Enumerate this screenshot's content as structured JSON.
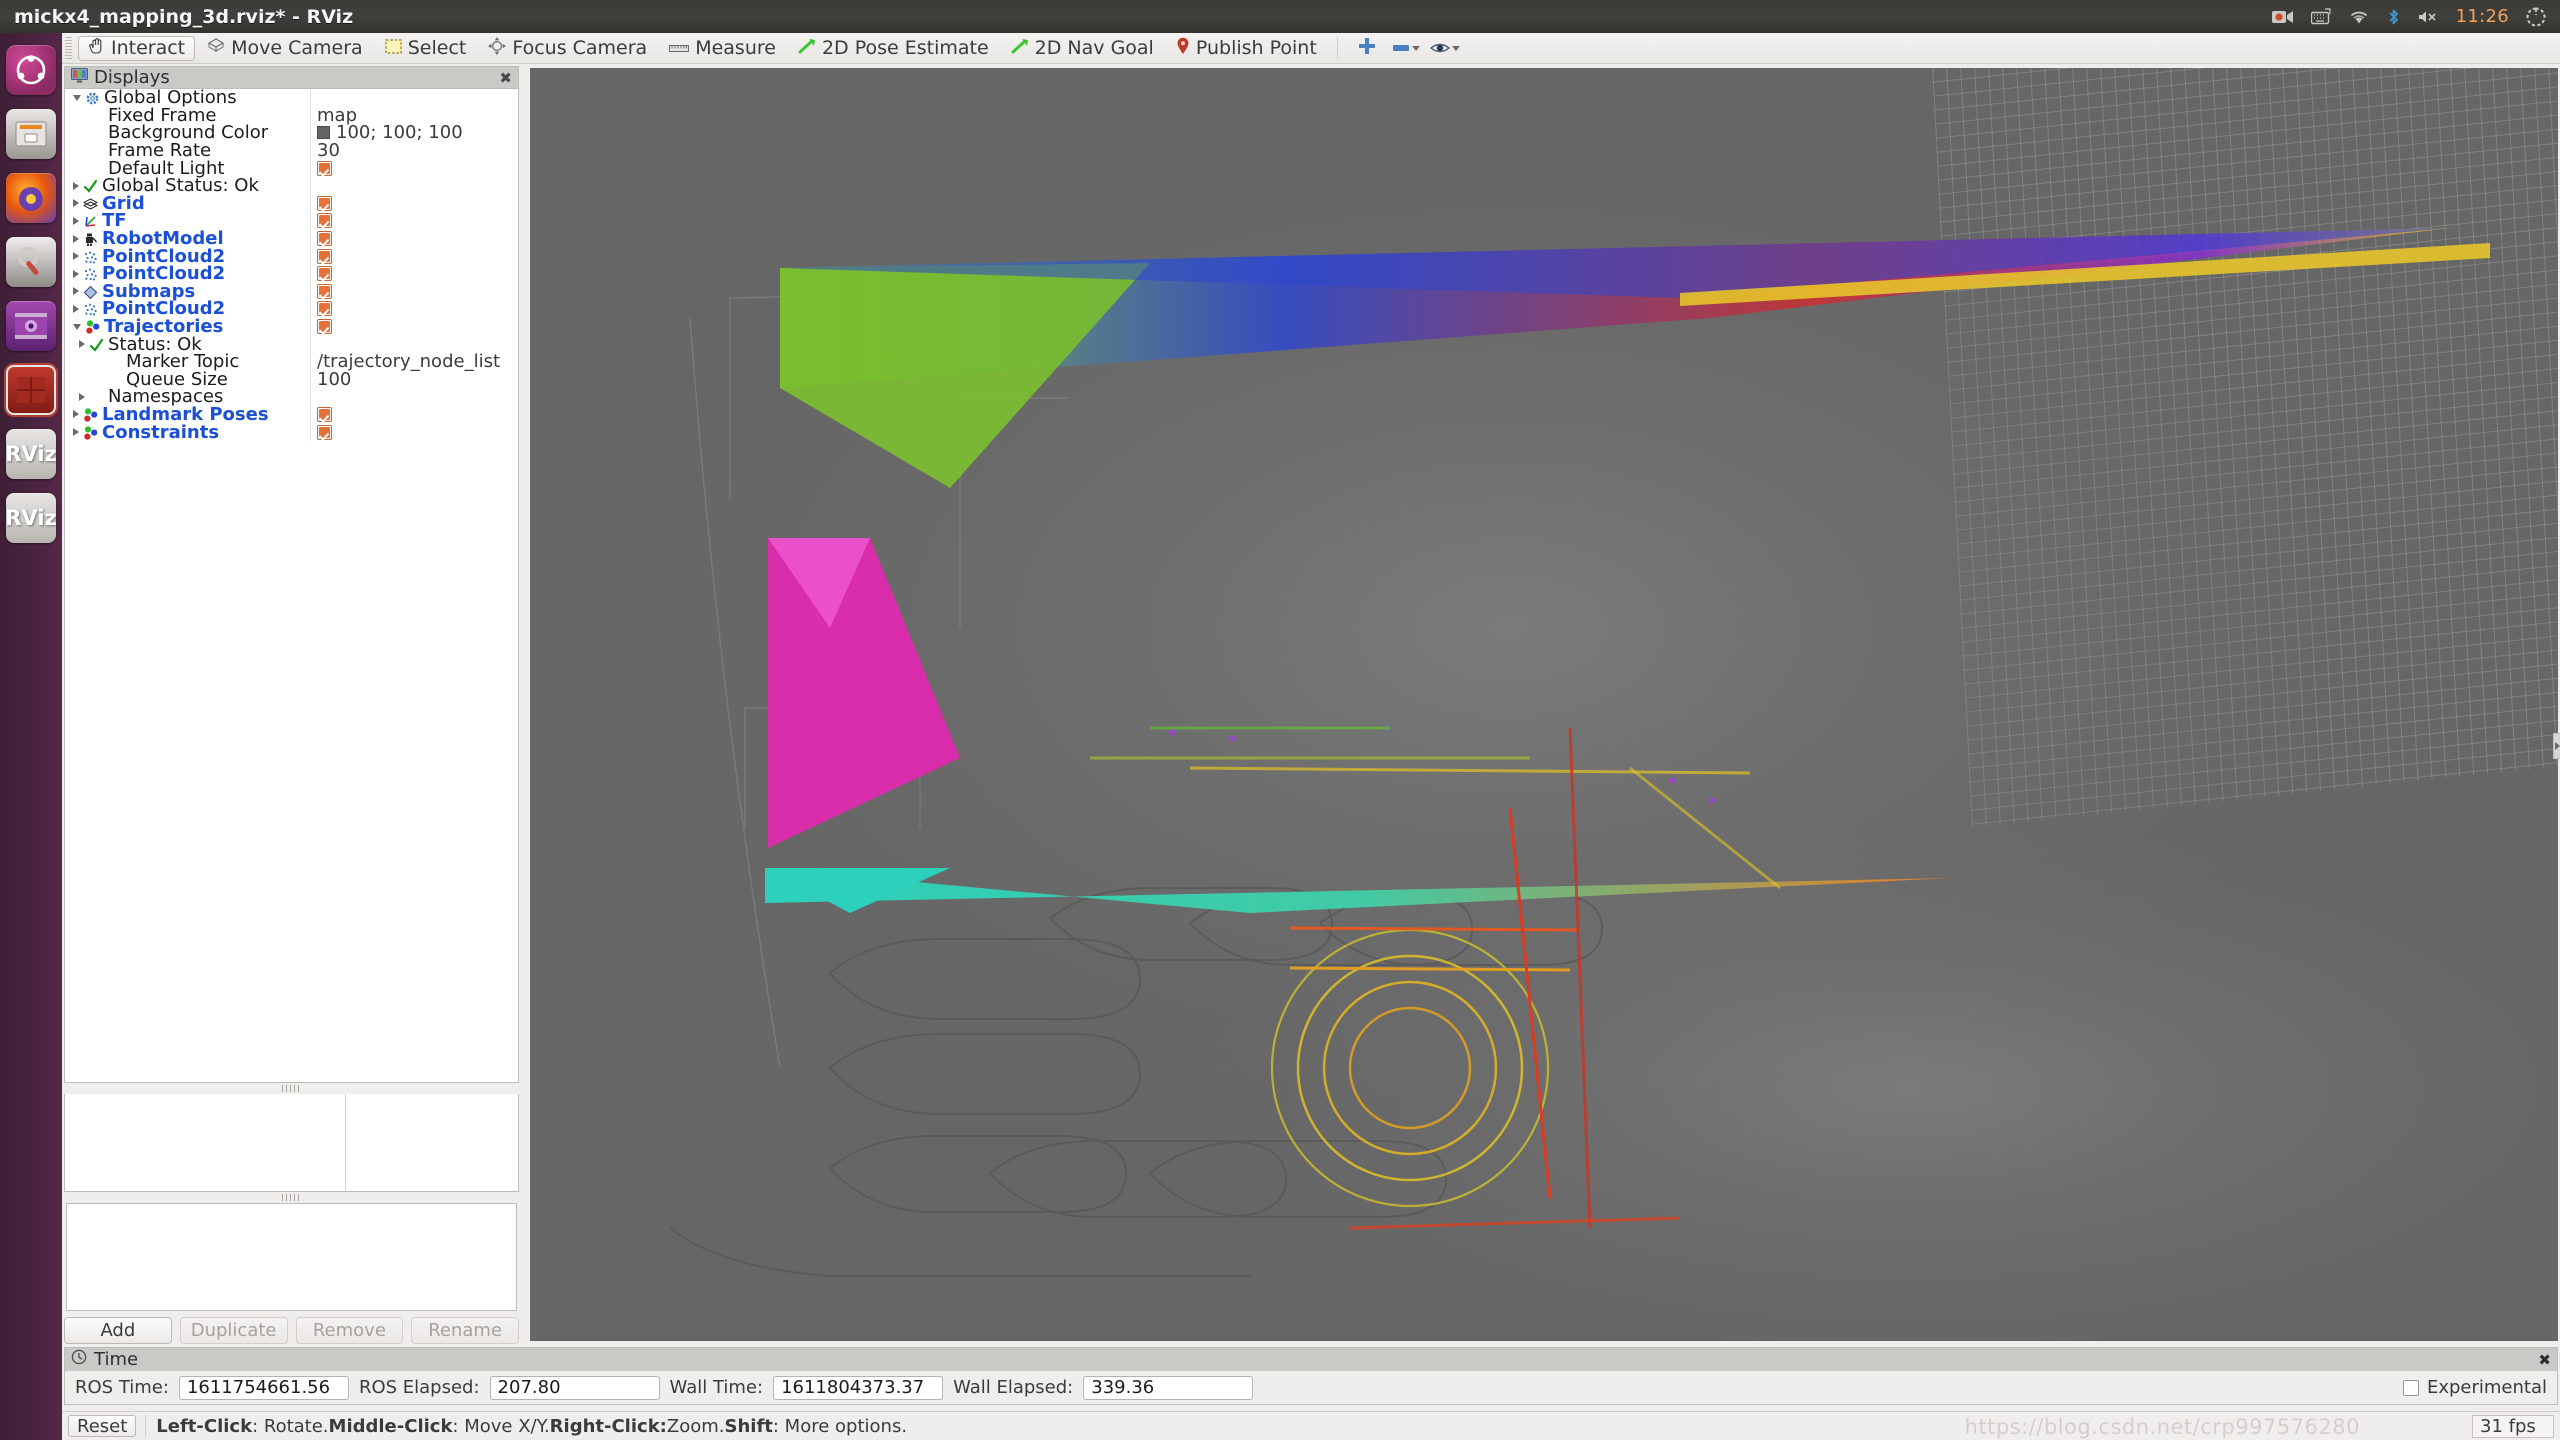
{
  "window": {
    "title": "mickx4_mapping_3d.rviz* - RViz"
  },
  "system_tray": {
    "icons": [
      "screen-record-icon",
      "keyboard-layout-icon",
      "wifi-icon",
      "bluetooth-icon",
      "volume-muted-icon"
    ],
    "clock": "11:26",
    "session_icon": "power-gear-icon"
  },
  "launcher": {
    "items": [
      {
        "name": "ubuntu-dash",
        "label": "Ubuntu"
      },
      {
        "name": "files",
        "label": "Files"
      },
      {
        "name": "firefox",
        "label": "Firefox"
      },
      {
        "name": "settings",
        "label": "System Settings"
      },
      {
        "name": "media-player",
        "label": "Media Player"
      },
      {
        "name": "terminator",
        "label": "Terminator"
      },
      {
        "name": "rviz-1",
        "label": "RViz"
      },
      {
        "name": "rviz-2",
        "label": "RViz"
      }
    ]
  },
  "toolbar": {
    "buttons": [
      {
        "label": "Interact",
        "icon": "hand-cursor-icon",
        "active": true
      },
      {
        "label": "Move Camera",
        "icon": "move-camera-icon",
        "active": false
      },
      {
        "label": "Select",
        "icon": "selection-rect-icon",
        "active": false
      },
      {
        "label": "Focus Camera",
        "icon": "focus-camera-icon",
        "active": false
      },
      {
        "label": "Measure",
        "icon": "ruler-icon",
        "active": false
      },
      {
        "label": "2D Pose Estimate",
        "icon": "green-arrow-icon",
        "active": false
      },
      {
        "label": "2D Nav Goal",
        "icon": "green-arrow-icon",
        "active": false
      },
      {
        "label": "Publish Point",
        "icon": "map-pin-icon",
        "active": false
      }
    ],
    "extra_icons": [
      "add-tool-icon",
      "remove-tool-icon",
      "visibility-eye-icon"
    ]
  },
  "displays_panel": {
    "header": "Displays",
    "header_icon": "display-monitor-icon",
    "close_icon": "close-icon",
    "rows": [
      {
        "indent": 0,
        "arrow": "down",
        "icon": "gear-icon",
        "label": "Global Options",
        "style": "plain",
        "value_type": "none"
      },
      {
        "indent": 1,
        "arrow": "none",
        "icon": "",
        "label": "Fixed Frame",
        "style": "plain",
        "value_type": "text",
        "value": "map"
      },
      {
        "indent": 1,
        "arrow": "none",
        "icon": "",
        "label": "Background Color",
        "style": "plain",
        "value_type": "color",
        "value": "100; 100; 100",
        "color": "#646464"
      },
      {
        "indent": 1,
        "arrow": "none",
        "icon": "",
        "label": "Frame Rate",
        "style": "plain",
        "value_type": "text",
        "value": "30"
      },
      {
        "indent": 1,
        "arrow": "none",
        "icon": "",
        "label": "Default Light",
        "style": "plain",
        "value_type": "check"
      },
      {
        "indent": 0,
        "arrow": "right",
        "icon": "status-ok-icon",
        "label": "Global Status: Ok",
        "style": "plain",
        "value_type": "none"
      },
      {
        "indent": 0,
        "arrow": "right",
        "icon": "grid-icon",
        "label": "Grid",
        "style": "blue",
        "value_type": "check"
      },
      {
        "indent": 0,
        "arrow": "right",
        "icon": "tf-axes-icon",
        "label": "TF",
        "style": "blue",
        "value_type": "check"
      },
      {
        "indent": 0,
        "arrow": "right",
        "icon": "robot-model-icon",
        "label": "RobotModel",
        "style": "blue",
        "value_type": "check"
      },
      {
        "indent": 0,
        "arrow": "right",
        "icon": "pointcloud-icon",
        "label": "PointCloud2",
        "style": "blue",
        "value_type": "check"
      },
      {
        "indent": 0,
        "arrow": "right",
        "icon": "pointcloud-icon",
        "label": "PointCloud2",
        "style": "blue",
        "value_type": "check"
      },
      {
        "indent": 0,
        "arrow": "right",
        "icon": "submaps-icon",
        "label": "Submaps",
        "style": "blue",
        "value_type": "check"
      },
      {
        "indent": 0,
        "arrow": "right",
        "icon": "pointcloud-icon",
        "label": "PointCloud2",
        "style": "blue",
        "value_type": "check"
      },
      {
        "indent": 0,
        "arrow": "down",
        "icon": "markers-icon",
        "label": "Trajectories",
        "style": "blue",
        "value_type": "check"
      },
      {
        "indent": 1,
        "arrow": "right",
        "icon": "status-ok-icon",
        "label": "Status: Ok",
        "style": "plain",
        "value_type": "none"
      },
      {
        "indent": 2,
        "arrow": "none",
        "icon": "",
        "label": "Marker Topic",
        "style": "plain",
        "value_type": "text",
        "value": "/trajectory_node_list"
      },
      {
        "indent": 2,
        "arrow": "none",
        "icon": "",
        "label": "Queue Size",
        "style": "plain",
        "value_type": "text",
        "value": "100"
      },
      {
        "indent": 1,
        "arrow": "right",
        "icon": "",
        "label": "Namespaces",
        "style": "plain",
        "value_type": "none"
      },
      {
        "indent": 0,
        "arrow": "right",
        "icon": "markers-icon",
        "label": "Landmark Poses",
        "style": "blue",
        "value_type": "check"
      },
      {
        "indent": 0,
        "arrow": "right",
        "icon": "markers-icon",
        "label": "Constraints",
        "style": "blue",
        "value_type": "check"
      }
    ],
    "buttons": [
      {
        "label": "Add",
        "enabled": true
      },
      {
        "label": "Duplicate",
        "enabled": false
      },
      {
        "label": "Remove",
        "enabled": false
      },
      {
        "label": "Rename",
        "enabled": false
      }
    ]
  },
  "time_panel": {
    "header": "Time",
    "header_icon": "clock-icon",
    "close_icon": "close-icon",
    "fields": [
      {
        "label": "ROS Time:",
        "value": "1611754661.56"
      },
      {
        "label": "ROS Elapsed:",
        "value": "207.80"
      },
      {
        "label": "Wall Time:",
        "value": "1611804373.37"
      },
      {
        "label": "Wall Elapsed:",
        "value": "339.36"
      }
    ],
    "experimental_label": "Experimental",
    "experimental_checked": false
  },
  "status_bar": {
    "reset_label": "Reset",
    "hint_parts": [
      {
        "text": "Left-Click",
        "bold": true
      },
      {
        "text": ": Rotate.  ",
        "bold": false
      },
      {
        "text": "Middle-Click",
        "bold": true
      },
      {
        "text": ": Move X/Y.  ",
        "bold": false
      },
      {
        "text": "Right-Click:",
        "bold": true
      },
      {
        "text": " Zoom.  ",
        "bold": false
      },
      {
        "text": "Shift",
        "bold": true
      },
      {
        "text": ": More options.",
        "bold": false
      }
    ],
    "fps": "31 fps"
  },
  "watermark": "https://blog.csdn.net/crp997576280",
  "viewport": {
    "background_color": "#666666",
    "trajectory_colors": [
      "#8ad62a",
      "#2a46d6",
      "#d62a2a",
      "#8a2ad6",
      "#e6c32a",
      "#e02ab0",
      "#2ad6c0",
      "#f08020"
    ]
  }
}
